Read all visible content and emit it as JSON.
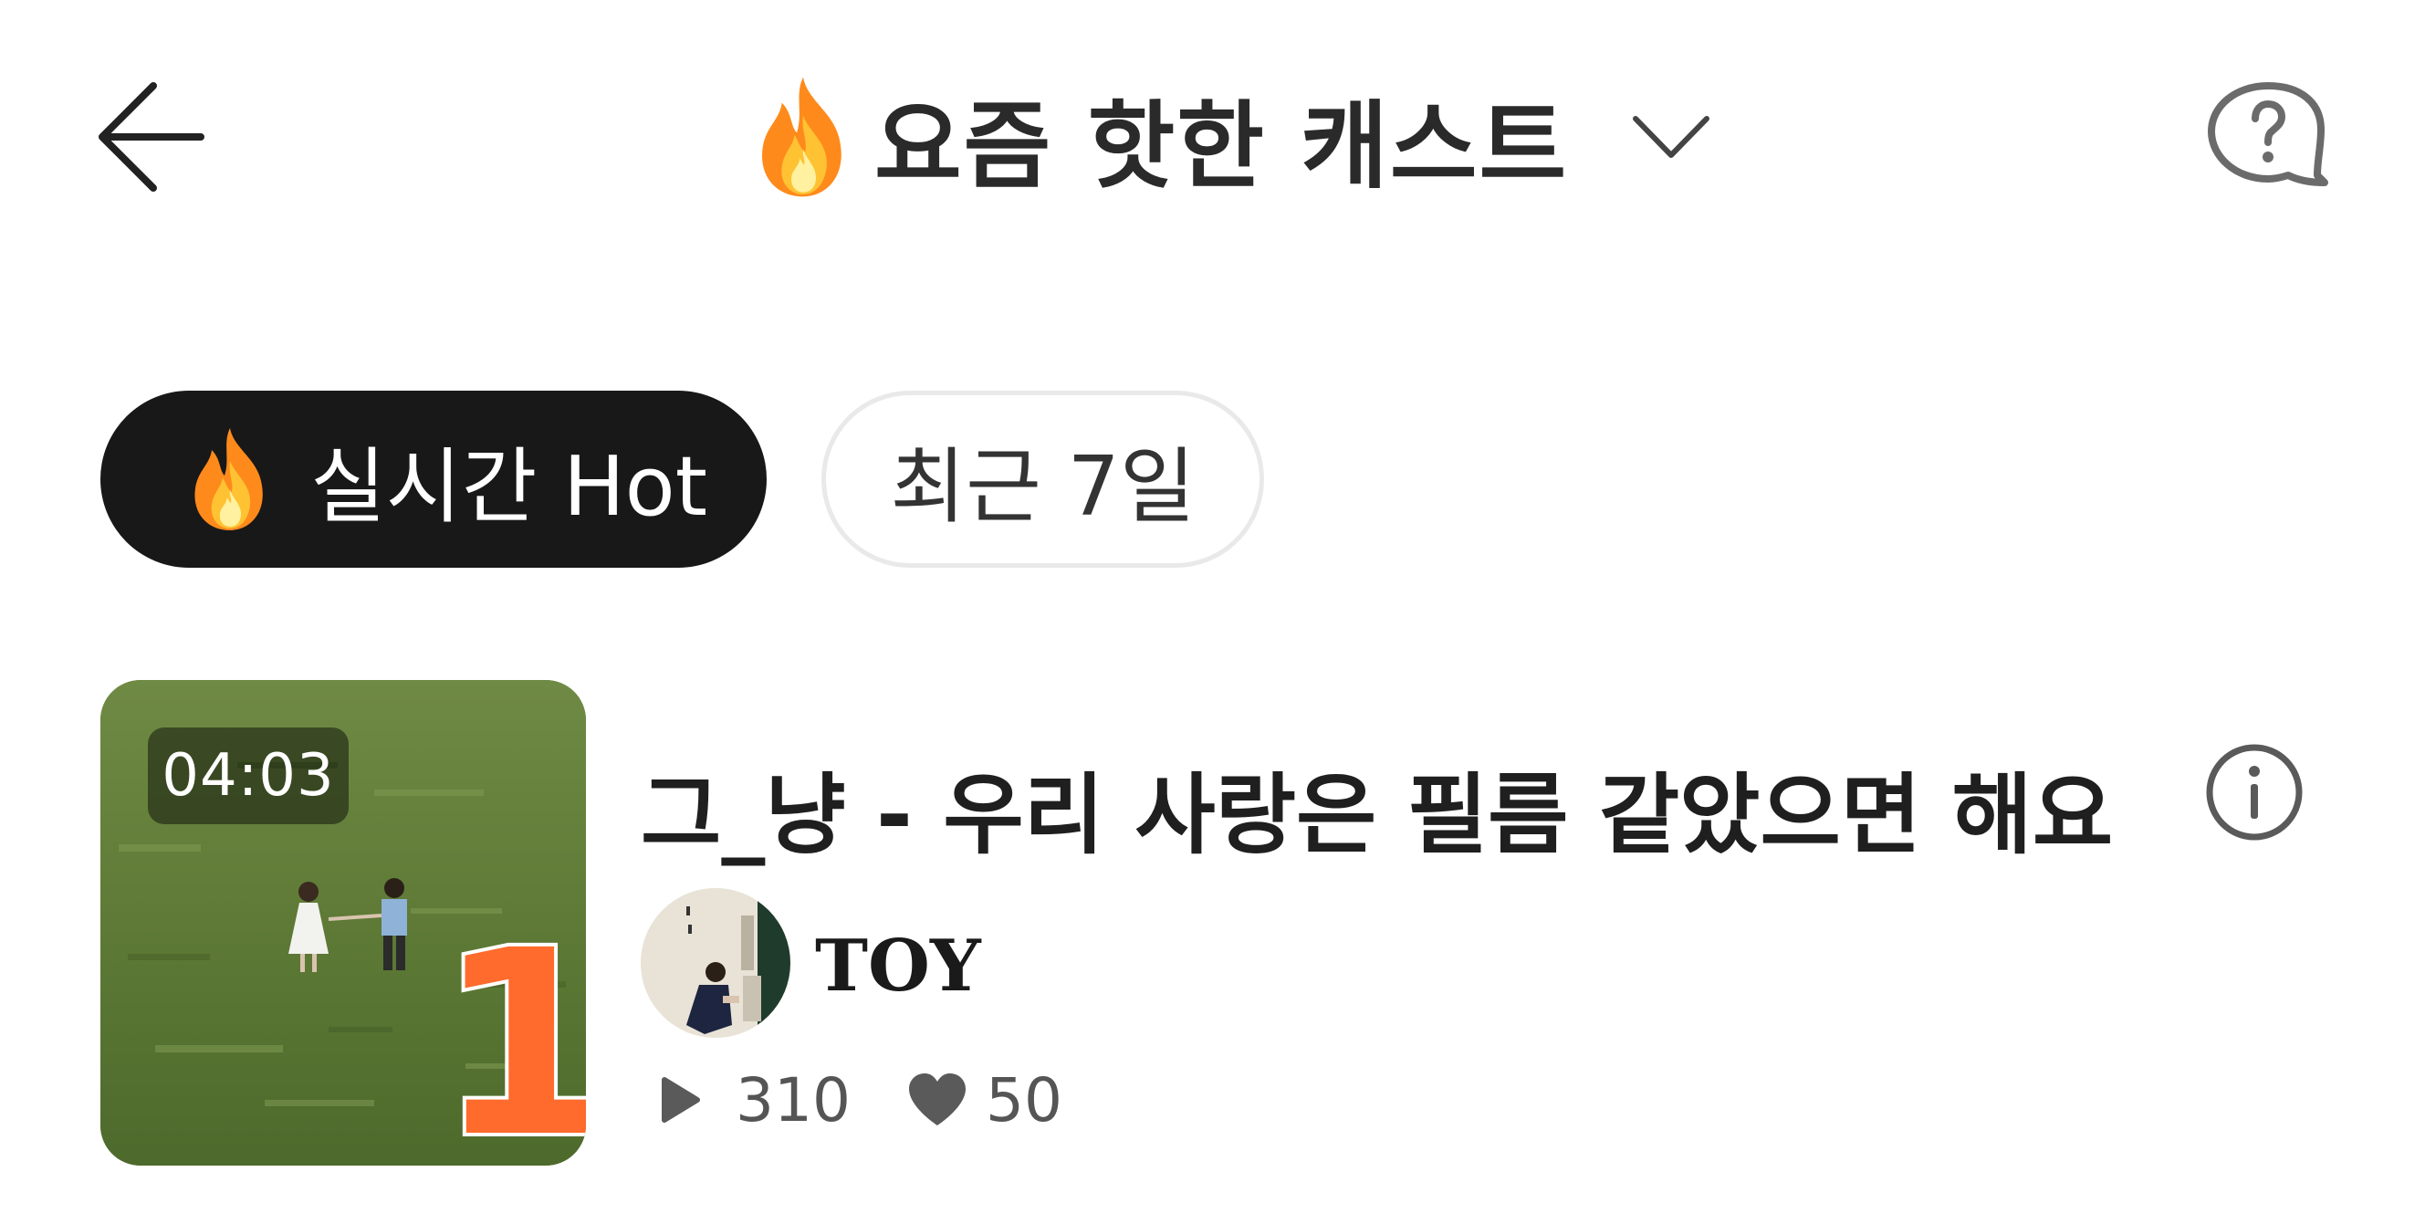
{
  "header": {
    "title": "요즘 핫한 캐스트",
    "back_icon": "arrow-left-icon",
    "title_icon": "fire-icon",
    "dropdown_icon": "chevron-down-icon",
    "help_icon": "help-bubble-icon"
  },
  "tabs": [
    {
      "label": "실시간 Hot",
      "icon": "fire-icon",
      "selected": true
    },
    {
      "label": "최근 7일",
      "selected": false
    }
  ],
  "list": [
    {
      "rank": "1",
      "duration": "04:03",
      "title": "그_냥 - 우리 사랑은 필름 같았으면 해요",
      "channel": "TOY",
      "plays": "310",
      "likes": "50",
      "info_icon": "info-icon"
    }
  ],
  "colors": {
    "selected_tab_bg": "#181818",
    "rank_accent": "#ff6b2c",
    "text_primary": "#1f1f1f",
    "text_secondary": "#555555"
  }
}
